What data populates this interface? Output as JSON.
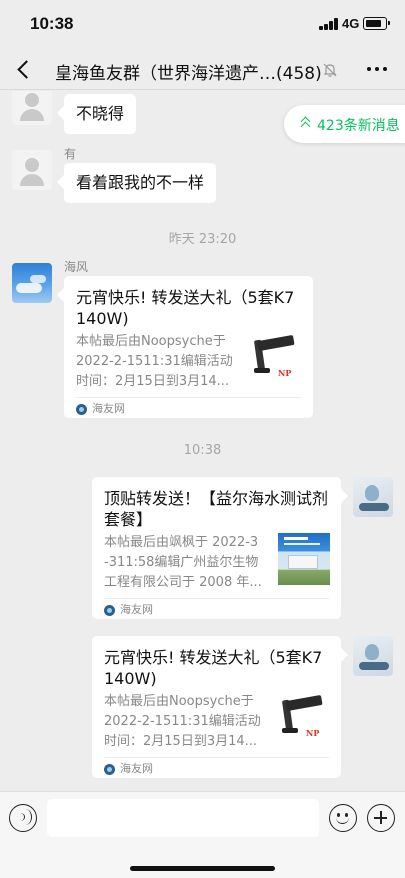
{
  "status_bar": {
    "time": "10:38",
    "network": "4G"
  },
  "header": {
    "title": "皇海鱼友群（世界海洋遗产…",
    "member_count": "(458)"
  },
  "unread_pill": {
    "label": "423条新消息"
  },
  "messages": {
    "m1": {
      "text": "不晓得"
    },
    "m2": {
      "sender": "有",
      "text": "看着跟我的不一样"
    },
    "sep1": "昨天 23:20",
    "m3": {
      "sender": "海风",
      "title": "元宵快乐! 转发送大礼（5套K7 140W)",
      "desc": [
        "本帖最后由Noopsyche于",
        "2022-2-1511:31编辑活动",
        "时间：2月15日到3月14..."
      ],
      "source": "海友网"
    },
    "sep2": "10:38",
    "m4": {
      "title": "顶贴转发送！【益尔海水测试剂套餐】",
      "desc": [
        "本帖最后由飒枫于 2022-3",
        "-311:58编辑广州益尔生物",
        "工程有限公司于 2008 年..."
      ],
      "source": "海友网"
    },
    "m5": {
      "title": "元宵快乐! 转发送大礼（5套K7 140W)",
      "desc": [
        "本帖最后由Noopsyche于",
        "2022-2-1511:31编辑活动",
        "时间：2月15日到3月14..."
      ],
      "source": "海友网"
    }
  },
  "input_bar": {
    "placeholder": ""
  },
  "icons": {
    "back": "chevron-left-icon",
    "mute": "bell-off-icon",
    "more": "ellipsis-icon",
    "voice": "voice-icon",
    "emoji": "emoji-icon",
    "plus": "plus-icon",
    "unread": "double-chevron-up-icon",
    "source": "haiyou-logo-icon"
  },
  "colors": {
    "accent": "#07c160",
    "background": "#ededed",
    "bubble": "#ffffff"
  }
}
